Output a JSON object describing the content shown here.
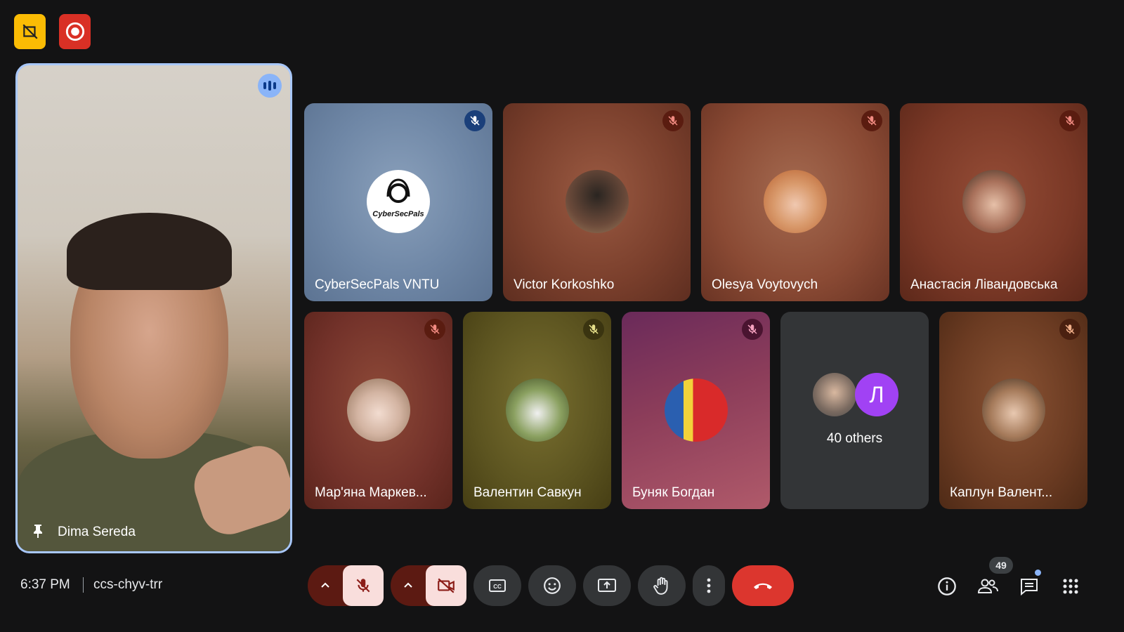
{
  "top_indicators": {
    "captions_off_icon": "no-video-record-icon",
    "recording_icon": "record-icon",
    "captions_color": "#fbbc04",
    "recording_color": "#d93025"
  },
  "pinned": {
    "name": "Dima Sereda",
    "pin_icon": "pin-icon",
    "speaking_icon": "speaking-indicator-icon"
  },
  "tiles": [
    {
      "name": "CyberSecPals VNTU",
      "logo_text": "CyberSecPals",
      "bg": "#6f87a6"
    },
    {
      "name": "Victor Korkoshko",
      "bg": "#7a3f2c"
    },
    {
      "name": "Olesya Voytovych",
      "bg": "#8a4a34"
    },
    {
      "name": "Анастасія Лівандовська",
      "bg": "#7a3826"
    },
    {
      "name": "Мар'яна Маркев...",
      "bg": "#73322a"
    },
    {
      "name": "Валентин Савкун",
      "bg": "#5c5420"
    },
    {
      "name": "Буняк Богдан",
      "bg": "#8c3d5a"
    },
    {
      "name": "Каплун Валент...",
      "bg": "#6b3b22"
    }
  ],
  "others": {
    "label": "40 others",
    "initial": "Л",
    "initial_color": "#a142f4"
  },
  "meeting": {
    "time": "6:37 PM",
    "code": "ccs-chyv-trr"
  },
  "controls": {
    "mic": "mic-off-icon",
    "camera": "video-off-icon",
    "captions": "closed-captions-icon",
    "emoji": "emoji-icon",
    "present": "present-screen-icon",
    "raise_hand": "raise-hand-icon",
    "more": "more-options-icon",
    "leave": "end-call-icon",
    "leave_color": "#dc362e"
  },
  "right_panel": {
    "participants_count": "49"
  }
}
